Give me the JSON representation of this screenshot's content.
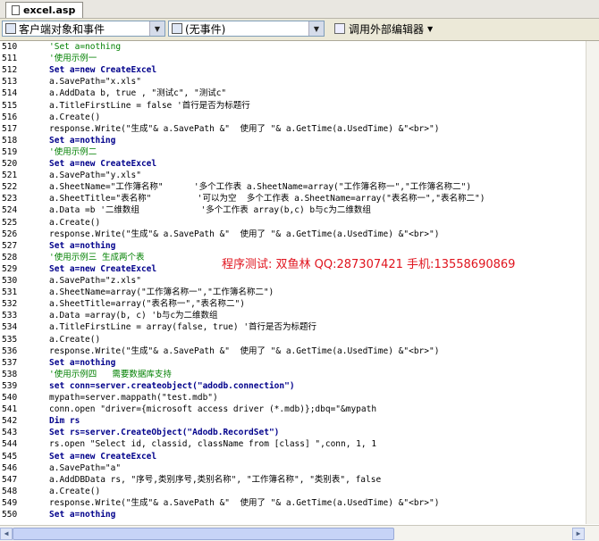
{
  "tab": {
    "label": "excel.asp"
  },
  "toolbar": {
    "object_combo": "客户端对象和事件",
    "event_combo": "(无事件)",
    "external_editor": "调用外部编辑器"
  },
  "annotation": "程序测试: 双鱼林 QQ:287307421 手机:13558690869",
  "lines": [
    {
      "n": "510",
      "t": "'Set a=nothing"
    },
    {
      "n": "511",
      "t": "'使用示例一"
    },
    {
      "n": "512",
      "t": "Set a=new CreateExcel"
    },
    {
      "n": "513",
      "t": "a.SavePath=\"x.xls\""
    },
    {
      "n": "514",
      "t": "a.AddData b, true , \"测试c\", \"测试c\""
    },
    {
      "n": "515",
      "t": "a.TitleFirstLine = false '首行是否为标题行"
    },
    {
      "n": "516",
      "t": "a.Create()"
    },
    {
      "n": "517",
      "t": "response.Write(\"生成\"& a.SavePath &\"  使用了 \"& a.GetTime(a.UsedTime) &\"<br>\")"
    },
    {
      "n": "518",
      "t": "Set a=nothing"
    },
    {
      "n": "519",
      "t": "'使用示例二"
    },
    {
      "n": "520",
      "t": "Set a=new CreateExcel"
    },
    {
      "n": "521",
      "t": "a.SavePath=\"y.xls\""
    },
    {
      "n": "522",
      "t": "a.SheetName=\"工作簿名称\"      '多个工作表 a.SheetName=array(\"工作簿名称一\",\"工作簿名称二\")"
    },
    {
      "n": "523",
      "t": "a.SheetTitle=\"表名称\"         '可以为空  多个工作表 a.SheetName=array(\"表名称一\",\"表名称二\")"
    },
    {
      "n": "524",
      "t": "a.Data =b '二维数组            '多个工作表 array(b,c) b与c为二维数组"
    },
    {
      "n": "525",
      "t": "a.Create()"
    },
    {
      "n": "526",
      "t": "response.Write(\"生成\"& a.SavePath &\"  使用了 \"& a.GetTime(a.UsedTime) &\"<br>\")"
    },
    {
      "n": "527",
      "t": "Set a=nothing"
    },
    {
      "n": "528",
      "t": "'使用示例三 生成两个表"
    },
    {
      "n": "529",
      "t": "Set a=new CreateExcel"
    },
    {
      "n": "530",
      "t": "a.SavePath=\"z.xls\""
    },
    {
      "n": "531",
      "t": "a.SheetName=array(\"工作簿名称一\",\"工作簿名称二\")"
    },
    {
      "n": "532",
      "t": "a.SheetTitle=array(\"表名称一\",\"表名称二\")"
    },
    {
      "n": "533",
      "t": "a.Data =array(b, c) 'b与c为二维数组"
    },
    {
      "n": "534",
      "t": "a.TitleFirstLine = array(false, true) '首行是否为标题行"
    },
    {
      "n": "535",
      "t": "a.Create()"
    },
    {
      "n": "536",
      "t": "response.Write(\"生成\"& a.SavePath &\"  使用了 \"& a.GetTime(a.UsedTime) &\"<br>\")"
    },
    {
      "n": "537",
      "t": "Set a=nothing"
    },
    {
      "n": "538",
      "t": "'使用示例四   需要数据库支持"
    },
    {
      "n": "539",
      "t": "set conn=server.createobject(\"adodb.connection\")"
    },
    {
      "n": "540",
      "t": "mypath=server.mappath(\"test.mdb\")"
    },
    {
      "n": "541",
      "t": "conn.open \"driver={microsoft access driver (*.mdb)};dbq=\"&mypath"
    },
    {
      "n": "542",
      "t": "Dim rs"
    },
    {
      "n": "543",
      "t": "Set rs=server.CreateObject(\"Adodb.RecordSet\")"
    },
    {
      "n": "544",
      "t": "rs.open \"Select id, classid, className from [class] \",conn, 1, 1"
    },
    {
      "n": "545",
      "t": "Set a=new CreateExcel"
    },
    {
      "n": "546",
      "t": "a.SavePath=\"a\""
    },
    {
      "n": "547",
      "t": "a.AddDBData rs, \"序号,类别序号,类别名称\", \"工作簿名称\", \"类别表\", false"
    },
    {
      "n": "548",
      "t": "a.Create()"
    },
    {
      "n": "549",
      "t": "response.Write(\"生成\"& a.SavePath &\"  使用了 \"& a.GetTime(a.UsedTime) &\"<br>\")"
    },
    {
      "n": "550",
      "t": "Set a=nothing"
    }
  ],
  "colors": {
    "keyword": "#00008b",
    "comment": "#008000",
    "string": "#8b0000",
    "annotation": "#e0141e"
  }
}
